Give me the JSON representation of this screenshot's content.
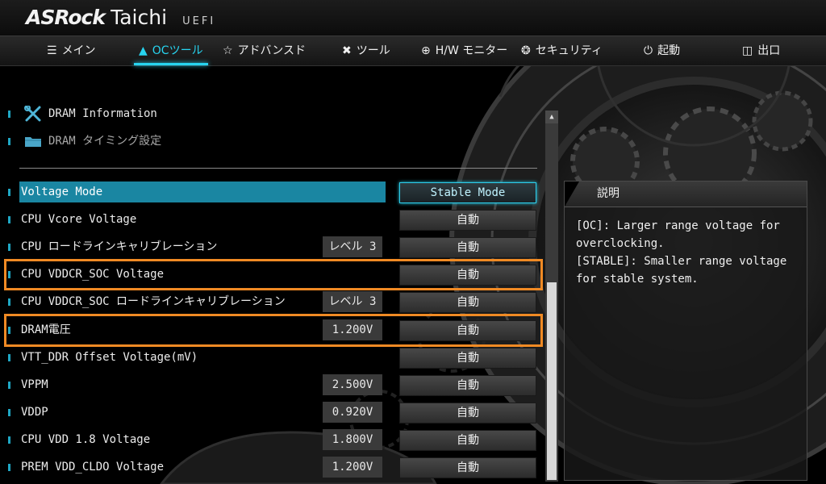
{
  "brand": {
    "name": "ASRock",
    "product": "Taichi",
    "firmware": "UEFI"
  },
  "nav": {
    "tabs": [
      {
        "label": "メイン",
        "icon": "list-icon",
        "active": false
      },
      {
        "label": "OCツール",
        "icon": "rocket-icon",
        "active": true
      },
      {
        "label": "アドバンスド",
        "icon": "star-icon",
        "active": false
      },
      {
        "label": "ツール",
        "icon": "tools-icon",
        "active": false
      },
      {
        "label": "H/W モニター",
        "icon": "crosshair-icon",
        "active": false
      },
      {
        "label": "セキュリティ",
        "icon": "shield-icon",
        "active": false
      },
      {
        "label": "起動",
        "icon": "power-icon",
        "active": false
      },
      {
        "label": "出口",
        "icon": "exit-door-icon",
        "active": false
      }
    ]
  },
  "links": [
    {
      "label": "DRAM Information",
      "icon": "wrench-screwdriver-icon"
    },
    {
      "label": "DRAM タイミング設定",
      "icon": "folder-icon"
    }
  ],
  "settings": [
    {
      "name": "Voltage Mode",
      "extra": "",
      "value": "Stable Mode"
    },
    {
      "name": "CPU Vcore Voltage",
      "extra": "",
      "value": "自動"
    },
    {
      "name": "CPU ロードラインキャリブレーション",
      "extra": "レベル 3",
      "value": "自動"
    },
    {
      "name": "CPU VDDCR_SOC Voltage",
      "extra": "",
      "value": "自動"
    },
    {
      "name": "CPU VDDCR_SOC ロードラインキャリブレーション",
      "extra": "レベル 3",
      "value": "自動"
    },
    {
      "name": "DRAM電圧",
      "extra": "1.200V",
      "value": "自動"
    },
    {
      "name": "VTT_DDR Offset Voltage(mV)",
      "extra": "",
      "value": "自動"
    },
    {
      "name": "VPPM",
      "extra": "2.500V",
      "value": "自動"
    },
    {
      "name": "VDDP",
      "extra": "0.920V",
      "value": "自動"
    },
    {
      "name": "CPU VDD 1.8 Voltage",
      "extra": "1.800V",
      "value": "自動"
    },
    {
      "name": "PREM VDD_CLDO Voltage",
      "extra": "1.200V",
      "value": "自動"
    }
  ],
  "description": {
    "title": "説明",
    "text": "[OC]: Larger range voltage for\noverclocking.\n[STABLE]: Smaller range voltage\nfor stable system."
  },
  "colors": {
    "accent": "#27d4f0",
    "selection": "#1a86a2",
    "highlight_box": "#f08a24"
  }
}
